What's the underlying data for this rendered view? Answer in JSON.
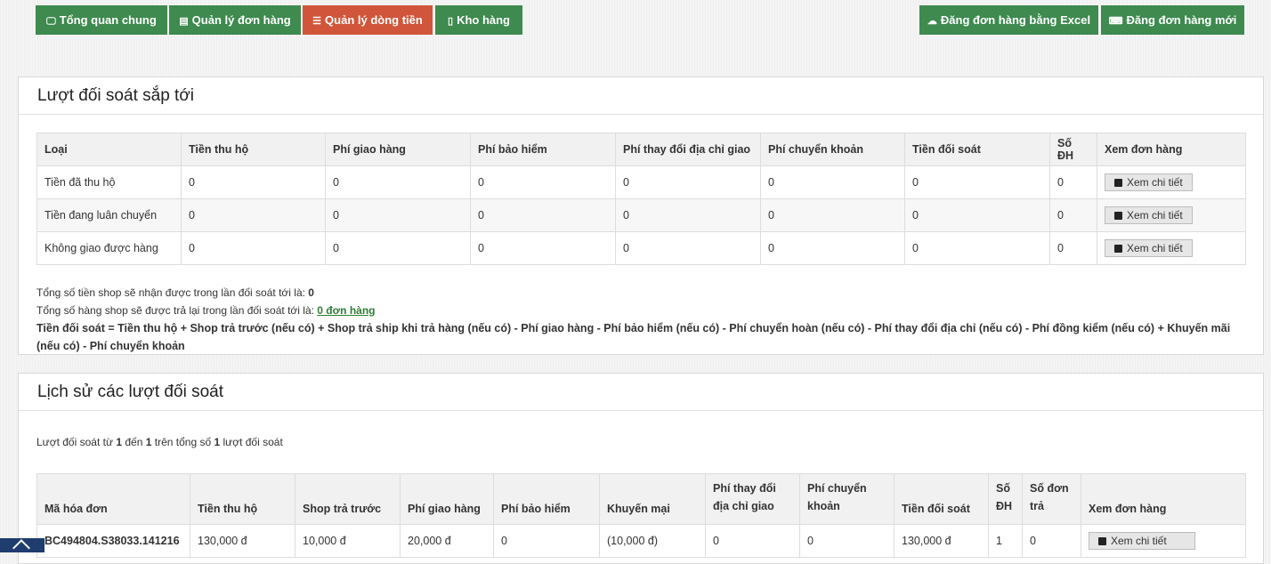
{
  "nav": {
    "overview": "Tổng quan chung",
    "orders": "Quản lý đơn hàng",
    "cashflow": "Quản lý dòng tiền",
    "warehouse": "Kho hàng",
    "excel_upload": "Đăng đơn hàng bằng Excel",
    "new_order": "Đăng đơn hàng mới"
  },
  "upcoming": {
    "title": "Lượt đối soát sắp tới",
    "headers": [
      "Loại",
      "Tiền thu hộ",
      "Phí giao hàng",
      "Phí bảo hiểm",
      "Phí thay đổi địa chỉ giao",
      "Phí chuyển khoản",
      "Tiền đối soát",
      "Số ĐH",
      "Xem đơn hàng"
    ],
    "rows": [
      {
        "type": "Tiền đã thu hộ",
        "cod": "0",
        "ship_fee": "0",
        "insurance": "0",
        "address_fee": "0",
        "transfer_fee": "0",
        "reconcile": "0",
        "orders": "0",
        "view": "Xem chi tiết"
      },
      {
        "type": "Tiền đang luân chuyển",
        "cod": "0",
        "ship_fee": "0",
        "insurance": "0",
        "address_fee": "0",
        "transfer_fee": "0",
        "reconcile": "0",
        "orders": "0",
        "view": "Xem chi tiết"
      },
      {
        "type": "Không giao được hàng",
        "cod": "0",
        "ship_fee": "0",
        "insurance": "0",
        "address_fee": "0",
        "transfer_fee": "0",
        "reconcile": "0",
        "orders": "0",
        "view": "Xem chi tiết"
      }
    ],
    "total_money_label": "Tổng số tiền shop sẽ nhận được trong lần đối soát tới là:",
    "total_money_value": "0",
    "total_returns_label": "Tổng số hàng shop sẽ được trả lại trong lần đối soát tới là:",
    "total_returns_link": "0 đơn hàng",
    "formula": "Tiền đối soát = Tiền thu hộ + Shop trả trước (nếu có) + Shop trả ship khi trả hàng (nếu có) - Phí giao hàng - Phí bảo hiểm (nếu có) - Phí chuyển hoàn (nếu có) - Phí thay đổi địa chỉ (nếu có) - Phí đồng kiểm (nếu có) + Khuyến mãi (nếu có) - Phí chuyển khoản"
  },
  "history": {
    "title": "Lịch sử các lượt đối soát",
    "summary_prefix": "Lượt đối soát từ",
    "summary_from": "1",
    "summary_to_word": "đến",
    "summary_to": "1",
    "summary_mid": "trên tổng số",
    "summary_total": "1",
    "summary_suffix": "lượt đối soát",
    "headers": [
      "Mã hóa đơn",
      "Tiền thu hộ",
      "Shop trả trước",
      "Phí giao hàng",
      "Phí bảo hiểm",
      "Khuyến mại",
      "Phí thay đổi địa chỉ giao",
      "Phí chuyển khoản",
      "Tiền đối soát",
      "Số ĐH",
      "Số đơn trả",
      "Xem đơn hàng"
    ],
    "rows": [
      {
        "invoice": "BC494804.S38033.141216",
        "cod": "130,000 đ",
        "prepaid": "10,000 đ",
        "ship_fee": "20,000 đ",
        "insurance": "0",
        "promo": "(10,000 đ)",
        "address_fee": "0",
        "transfer_fee": "0",
        "reconcile": "130,000 đ",
        "orders": "1",
        "returns": "0",
        "view": "Xem chi tiết"
      }
    ]
  },
  "icons": [
    "monitor-icon",
    "list-icon",
    "list-icon",
    "tablet-icon",
    "cloud-upload-icon",
    "keyboard-icon",
    "edit-icon",
    "scroll-top-icon"
  ],
  "colors": {
    "nav_green": "#3e8a4f",
    "nav_active": "#d1553a",
    "link_green": "#2e7d32"
  }
}
